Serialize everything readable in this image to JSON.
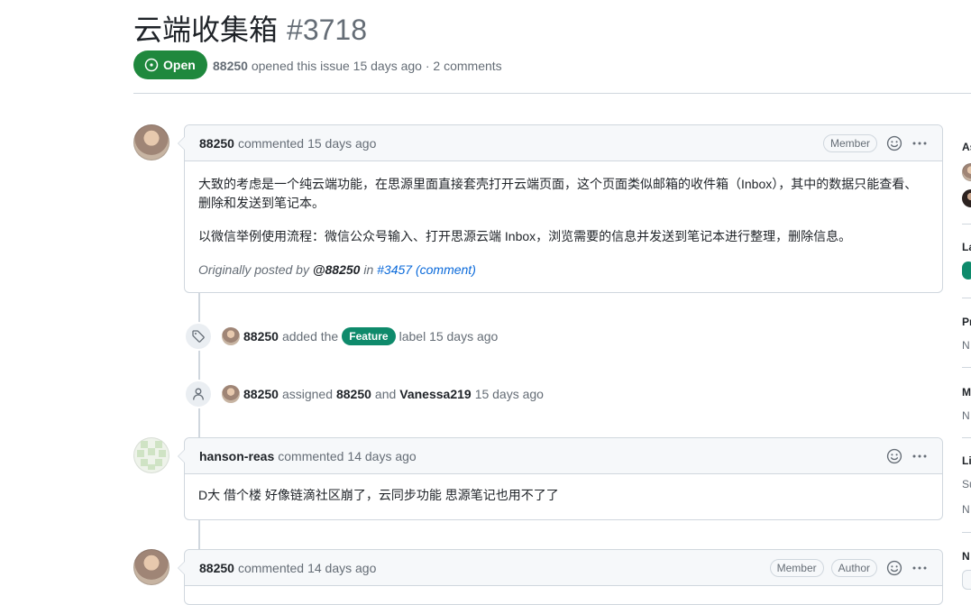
{
  "issue": {
    "title": "云端收集箱",
    "number": "#3718",
    "state": "Open",
    "author": "88250",
    "opened_text": "opened this issue 15 days ago · 2 comments"
  },
  "comments": [
    {
      "author": "88250",
      "action": "commented",
      "time": "15 days ago",
      "badges": [
        "Member"
      ],
      "body": [
        "大致的考虑是一个纯云端功能，在思源里面直接套壳打开云端页面，这个页面类似邮箱的收件箱（Inbox），其中的数据只能查看、删除和发送到笔记本。",
        "以微信举例使用流程：微信公众号输入、打开思源云端 Inbox，浏览需要的信息并发送到笔记本进行整理，删除信息。"
      ],
      "ref": {
        "prefix": "Originally posted by",
        "user": "@88250",
        "in": "in",
        "issue": "#3457",
        "link": "(comment)"
      }
    },
    {
      "author": "hanson-reas",
      "action": "commented",
      "time": "14 days ago",
      "badges": [],
      "body": [
        "D大 借个楼 好像链滴社区崩了，云同步功能 思源笔记也用不了了"
      ]
    },
    {
      "author": "88250",
      "action": "commented",
      "time": "14 days ago",
      "badges": [
        "Member",
        "Author"
      ]
    }
  ],
  "events": [
    {
      "icon": "tag-icon",
      "actor": "88250",
      "text_before": "added the",
      "label": "Feature",
      "label_color": "#0e8a6b",
      "text_after": "label 15 days ago"
    },
    {
      "icon": "person-icon",
      "actor": "88250",
      "text_before": "assigned",
      "assignee1": "88250",
      "and": "and",
      "assignee2": "Vanessa219",
      "time": "15 days ago"
    }
  ],
  "sidebar": {
    "frag_assignees": "As",
    "frag_labels": "La",
    "frag_projects": "Pr",
    "frag_projects_val": "N",
    "frag_milestone": "M",
    "frag_milestone_val": "N",
    "frag_linked": "Li",
    "frag_linked_sub": "Su",
    "frag_linked_val": "N",
    "frag_notifications": "N"
  },
  "colors": {
    "open_green": "#1f883d",
    "feature_label": "#0e8a6b",
    "link_blue": "#0969da"
  }
}
